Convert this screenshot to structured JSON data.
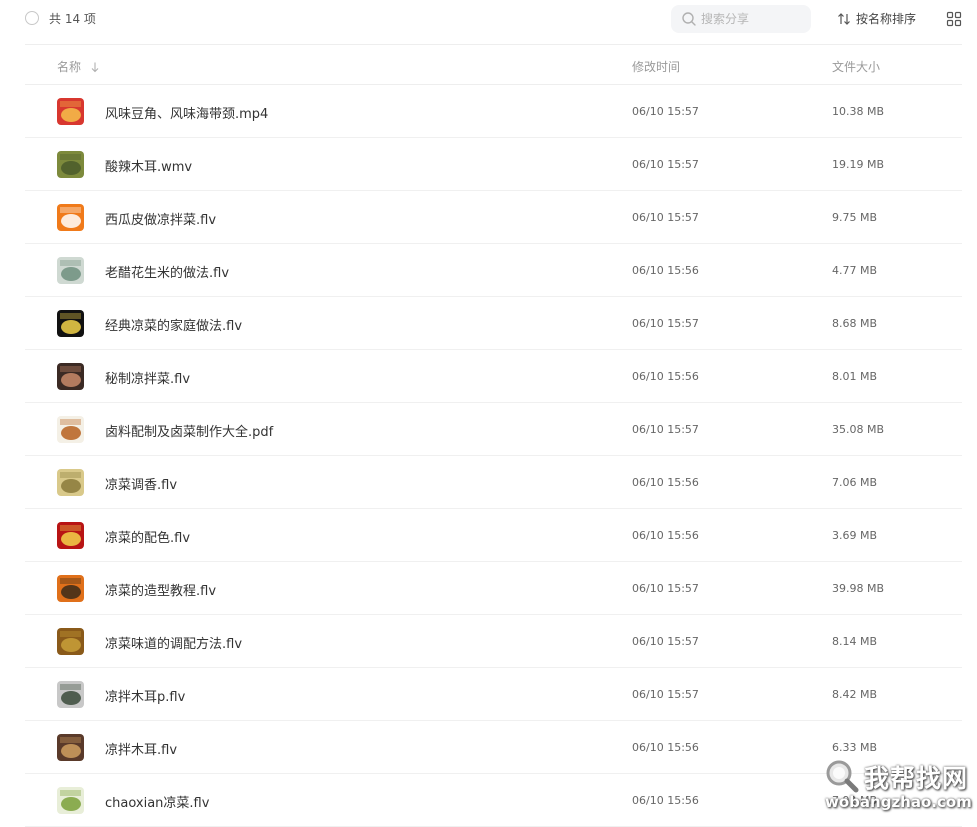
{
  "toolbar": {
    "count_label": "共 14 项",
    "search_placeholder": "搜索分享",
    "sort_label": "按名称排序",
    "icons": {
      "search": "search-icon",
      "sort": "sort-arrows-icon",
      "grid": "grid-view-icon",
      "select": "circle-checkbox-icon"
    }
  },
  "table": {
    "columns": {
      "name": "名称",
      "modified": "修改时间",
      "size": "文件大小"
    },
    "rows": [
      {
        "name": "风味豆角、风味海带颈.mp4",
        "modified": "06/10 15:57",
        "size": "10.38 MB",
        "thumb_colors": [
          "#d8372f",
          "#f6c04a"
        ]
      },
      {
        "name": "酸辣木耳.wmv",
        "modified": "06/10 15:57",
        "size": "19.19 MB",
        "thumb_colors": [
          "#7d8a3c",
          "#4a5a2a"
        ]
      },
      {
        "name": "西瓜皮做凉拌菜.flv",
        "modified": "06/10 15:57",
        "size": "9.75 MB",
        "thumb_colors": [
          "#f07a1a",
          "#ffffff"
        ]
      },
      {
        "name": "老醋花生米的做法.flv",
        "modified": "06/10 15:56",
        "size": "4.77 MB",
        "thumb_colors": [
          "#cfd9d2",
          "#6f8f7f"
        ]
      },
      {
        "name": "经典凉菜的家庭做法.flv",
        "modified": "06/10 15:57",
        "size": "8.68 MB",
        "thumb_colors": [
          "#111111",
          "#f2d24a"
        ]
      },
      {
        "name": "秘制凉拌菜.flv",
        "modified": "06/10 15:56",
        "size": "8.01 MB",
        "thumb_colors": [
          "#3b2a24",
          "#c98a6a"
        ]
      },
      {
        "name": "卤料配制及卤菜制作大全.pdf",
        "modified": "06/10 15:57",
        "size": "35.08 MB",
        "thumb_colors": [
          "#f4f0e6",
          "#b6601e"
        ]
      },
      {
        "name": "凉菜调香.flv",
        "modified": "06/10 15:56",
        "size": "7.06 MB",
        "thumb_colors": [
          "#d9c98a",
          "#8a7a3a"
        ]
      },
      {
        "name": "凉菜的配色.flv",
        "modified": "06/10 15:56",
        "size": "3.69 MB",
        "thumb_colors": [
          "#b81414",
          "#f2d24a"
        ]
      },
      {
        "name": "凉菜的造型教程.flv",
        "modified": "06/10 15:57",
        "size": "39.98 MB",
        "thumb_colors": [
          "#e0701a",
          "#3a2a1a"
        ]
      },
      {
        "name": "凉菜味道的调配方法.flv",
        "modified": "06/10 15:57",
        "size": "8.14 MB",
        "thumb_colors": [
          "#8a5a1a",
          "#c8a03a"
        ]
      },
      {
        "name": "凉拌木耳p.flv",
        "modified": "06/10 15:57",
        "size": "8.42 MB",
        "thumb_colors": [
          "#c8c8c8",
          "#3a4a3a"
        ]
      },
      {
        "name": "凉拌木耳.flv",
        "modified": "06/10 15:56",
        "size": "6.33 MB",
        "thumb_colors": [
          "#5a3a2a",
          "#d0a060"
        ]
      },
      {
        "name": "chaoxian凉菜.flv",
        "modified": "06/10 15:56",
        "size": "7.92 MB",
        "thumb_colors": [
          "#e8eed8",
          "#7aa03a"
        ]
      }
    ]
  },
  "watermark": {
    "title": "我帮找网",
    "url": "wobangzhao.com"
  },
  "colors": {
    "text": "#333333",
    "muted": "#9a9a9a",
    "divider": "#eeeeee",
    "search_bg": "#f4f5f7"
  }
}
